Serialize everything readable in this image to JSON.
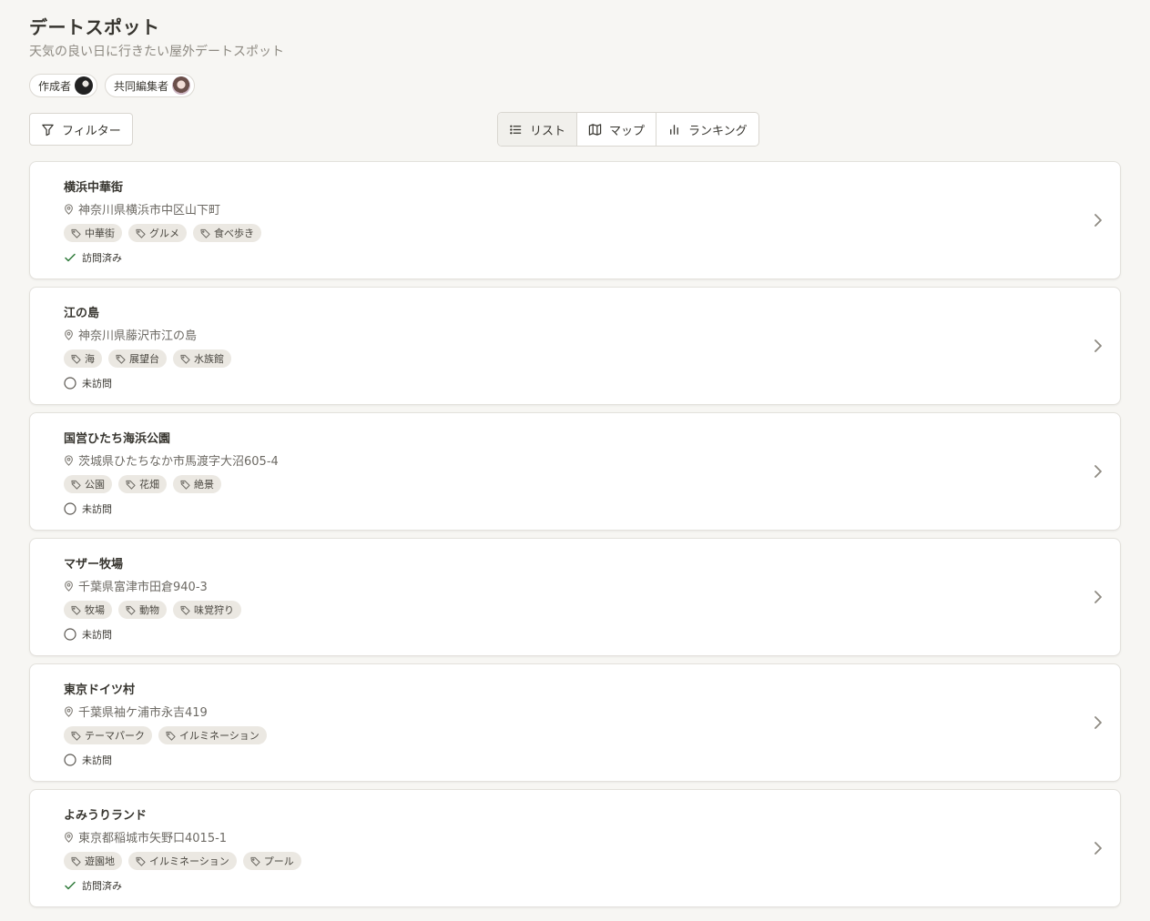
{
  "header": {
    "title": "デートスポット",
    "subtitle": "天気の良い日に行きたい屋外デートスポット"
  },
  "members": [
    {
      "role": "作成者",
      "avatar": "creator-avatar"
    },
    {
      "role": "共同編集者",
      "avatar": "collaborator-avatar"
    }
  ],
  "toolbar": {
    "filter_label": "フィルター",
    "view_tabs": [
      {
        "label": "リスト",
        "icon": "list-icon",
        "active": true
      },
      {
        "label": "マップ",
        "icon": "map-icon",
        "active": false
      },
      {
        "label": "ランキング",
        "icon": "bar-chart-icon",
        "active": false
      }
    ]
  },
  "spots": [
    {
      "name": "横浜中華街",
      "address": "神奈川県横浜市中区山下町",
      "tags": [
        "中華街",
        "グルメ",
        "食べ歩き"
      ],
      "status": "訪問済み",
      "visited": true
    },
    {
      "name": "江の島",
      "address": "神奈川県藤沢市江の島",
      "tags": [
        "海",
        "展望台",
        "水族館"
      ],
      "status": "未訪問",
      "visited": false
    },
    {
      "name": "国営ひたち海浜公園",
      "address": "茨城県ひたちなか市馬渡字大沼605-4",
      "tags": [
        "公園",
        "花畑",
        "絶景"
      ],
      "status": "未訪問",
      "visited": false
    },
    {
      "name": "マザー牧場",
      "address": "千葉県富津市田倉940-3",
      "tags": [
        "牧場",
        "動物",
        "味覚狩り"
      ],
      "status": "未訪問",
      "visited": false
    },
    {
      "name": "東京ドイツ村",
      "address": "千葉県袖ケ浦市永吉419",
      "tags": [
        "テーマパーク",
        "イルミネーション"
      ],
      "status": "未訪問",
      "visited": false
    },
    {
      "name": "よみうりランド",
      "address": "東京都稲城市矢野口4015-1",
      "tags": [
        "遊園地",
        "イルミネーション",
        "プール"
      ],
      "status": "訪問済み",
      "visited": true
    }
  ],
  "colors": {
    "background": "#f7f6f3",
    "card": "#ffffff",
    "tag_bg": "#ebe8e2",
    "visited_check": "#2f7a3a",
    "text": "#37352f",
    "muted": "#8e8a82"
  }
}
